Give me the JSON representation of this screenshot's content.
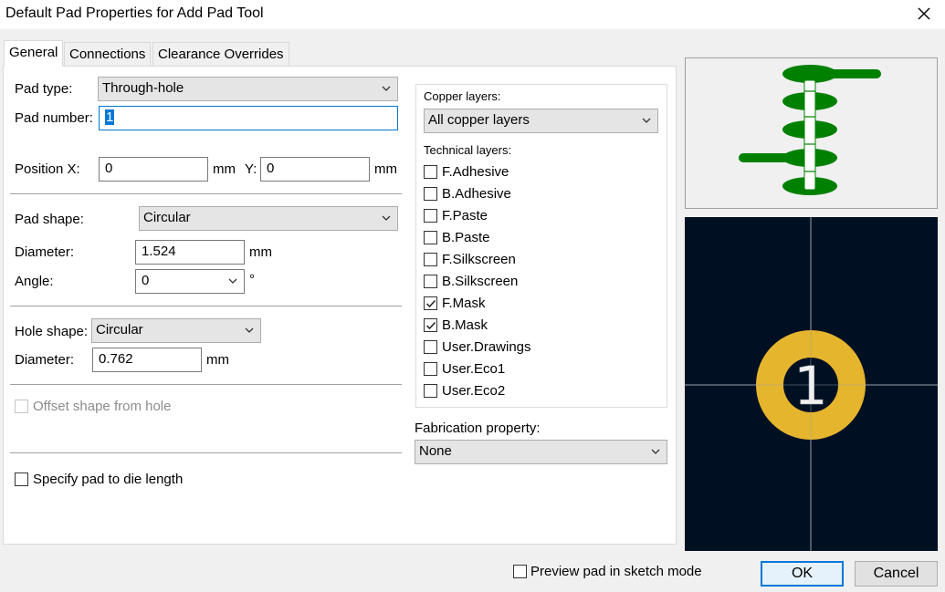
{
  "window": {
    "title": "Default Pad Properties for Add Pad Tool"
  },
  "tabs": [
    {
      "label": "General"
    },
    {
      "label": "Connections"
    },
    {
      "label": "Clearance Overrides"
    }
  ],
  "general": {
    "pad_type_label": "Pad type:",
    "pad_type_value": "Through-hole",
    "pad_number_label": "Pad number:",
    "pad_number_value": "1",
    "position_x_label": "Position X:",
    "position_x_value": "0",
    "position_x_unit": "mm",
    "position_y_label": "Y:",
    "position_y_value": "0",
    "position_y_unit": "mm",
    "pad_shape_label": "Pad shape:",
    "pad_shape_value": "Circular",
    "diameter_label": "Diameter:",
    "diameter_value": "1.524",
    "diameter_unit": "mm",
    "angle_label": "Angle:",
    "angle_value": "0",
    "angle_unit": "°",
    "hole_shape_label": "Hole shape:",
    "hole_shape_value": "Circular",
    "hole_diameter_label": "Diameter:",
    "hole_diameter_value": "0.762",
    "hole_diameter_unit": "mm",
    "offset_label": "Offset shape from hole",
    "die_length_label": "Specify pad to die length"
  },
  "layers": {
    "copper_label": "Copper layers:",
    "copper_value": "All copper layers",
    "technical_label": "Technical layers:",
    "items": [
      {
        "label": "F.Adhesive",
        "checked": false
      },
      {
        "label": "B.Adhesive",
        "checked": false
      },
      {
        "label": "F.Paste",
        "checked": false
      },
      {
        "label": "B.Paste",
        "checked": false
      },
      {
        "label": "F.Silkscreen",
        "checked": false
      },
      {
        "label": "B.Silkscreen",
        "checked": false
      },
      {
        "label": "F.Mask",
        "checked": true
      },
      {
        "label": "B.Mask",
        "checked": true
      },
      {
        "label": "User.Drawings",
        "checked": false
      },
      {
        "label": "User.Eco1",
        "checked": false
      },
      {
        "label": "User.Eco2",
        "checked": false
      }
    ],
    "fabrication_label": "Fabrication property:",
    "fabrication_value": "None"
  },
  "preview": {
    "pad_label": "1",
    "sketch_mode_label": "Preview pad in sketch mode",
    "pad_color": "#e6b52e",
    "background_color": "#001023",
    "layer_stack_color": "#008000"
  },
  "buttons": {
    "ok": "OK",
    "cancel": "Cancel"
  }
}
